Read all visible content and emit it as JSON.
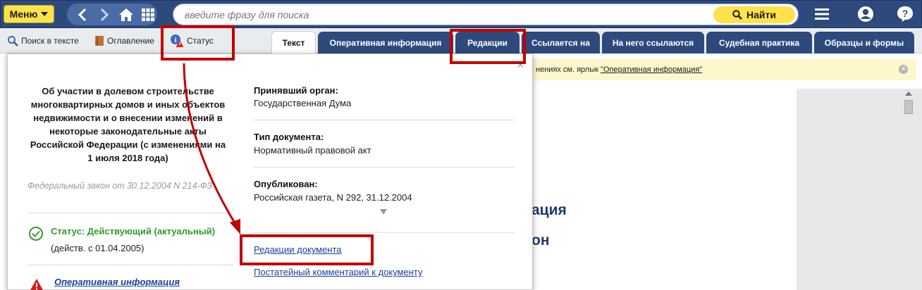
{
  "header": {
    "menu_label": "Меню",
    "search_placeholder": "введите фразу для поиска",
    "find_label": "Найти",
    "icons": [
      "back-icon",
      "forward-icon",
      "home-icon",
      "grid-icon",
      "hamburger-icon",
      "user-icon",
      "help-icon",
      "search-icon"
    ]
  },
  "toolbar": {
    "search_in_text": "Поиск в тексте",
    "contents": "Оглавление",
    "status": "Статус"
  },
  "tabs": [
    {
      "label": "Текст",
      "active": true
    },
    {
      "label": "Оперативная информация"
    },
    {
      "label": "Редакции"
    },
    {
      "label": "Ссылается на"
    },
    {
      "label": "На него ссылаются"
    },
    {
      "label": "Судебная практика"
    },
    {
      "label": "Образцы и формы"
    }
  ],
  "info_strip": {
    "text": "нениях см. ярлык",
    "link": "\"Оперативная информация\""
  },
  "document_fragments": [
    "ация",
    "он"
  ],
  "popup": {
    "close": "×",
    "title": "Об участии в долевом строительстве многоквартирных домов и иных объектов недвижимости и о внесении изменений в некоторые законодательные акты Российской Федерации (с изменениями на 1 июля 2018 года)",
    "subtitle": "Федеральный закон от 30.12.2004 N 214-ФЗ",
    "status_label": "Статус: Действующий (актуальный)",
    "status_date": "(действ. с 01.04.2005)",
    "operative_link": "Оперативная информация",
    "issuer_label": "Принявший орган:",
    "issuer_value": "Государственная Дума",
    "type_label": "Тип документа:",
    "type_value": "Нормативный правовой акт",
    "published_label": "Опубликован:",
    "published_value": "Российская газета, N 292, 31.12.2004",
    "editions_link": "Редакции документа",
    "commentary_link": "Постатейный комментарий к документу"
  },
  "colors": {
    "header_bg": "#2e4a7d",
    "accent_yellow": "#fde24a",
    "annotation_red": "#c30000",
    "status_green": "#2f9a2f",
    "link_blue": "#1a3fa0"
  }
}
